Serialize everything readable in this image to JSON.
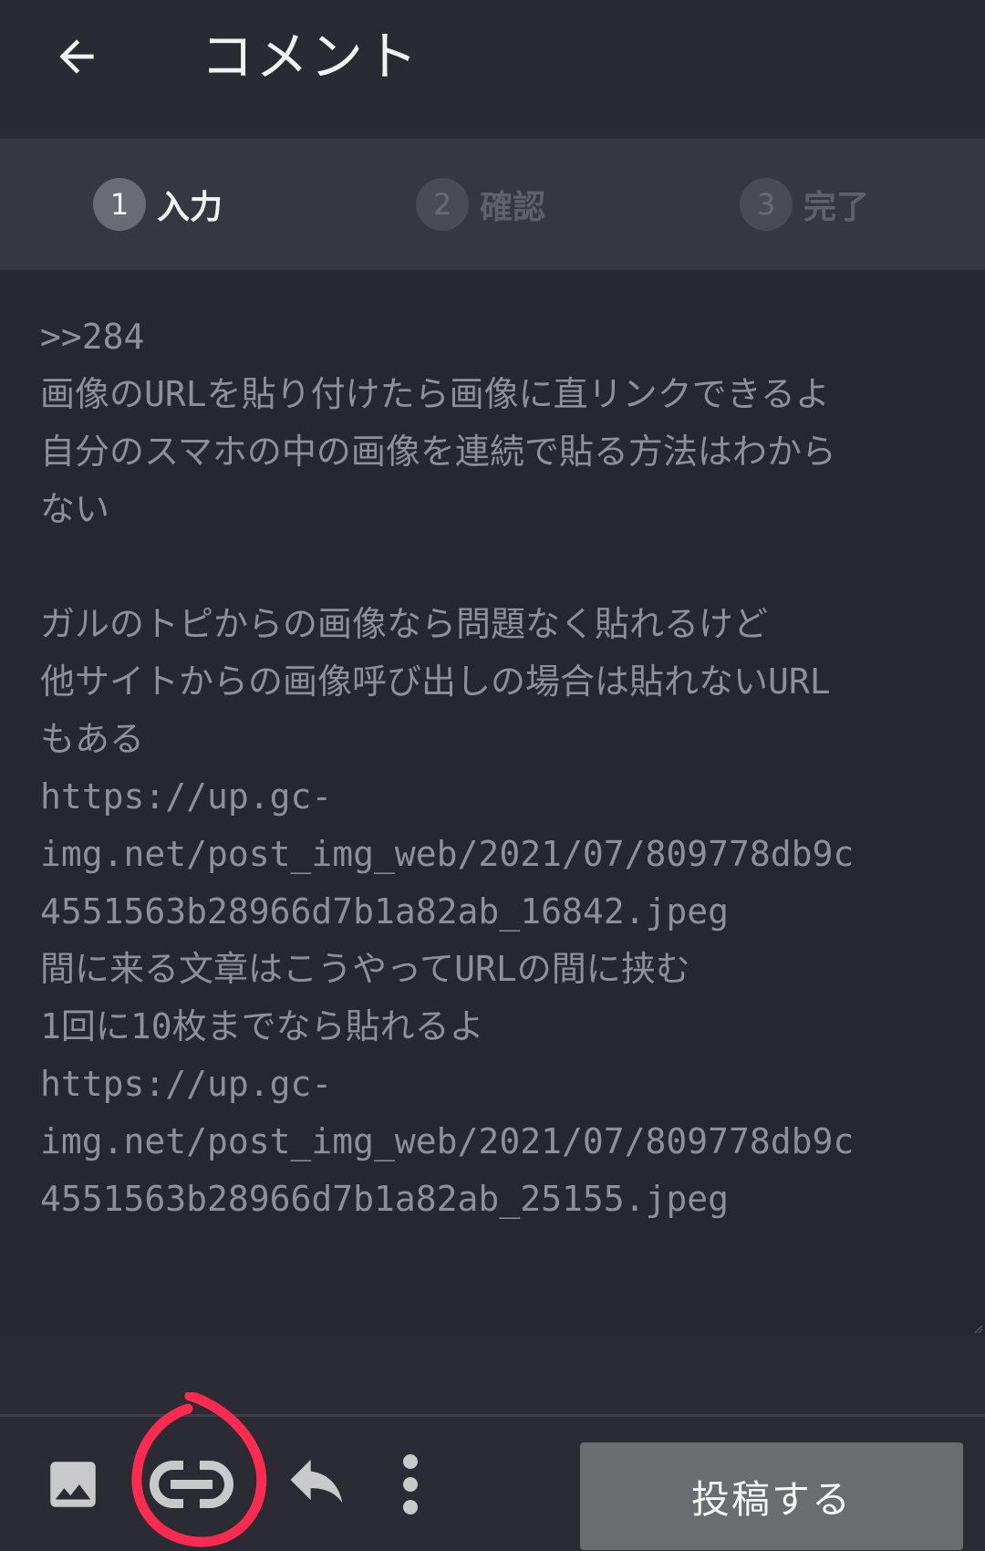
{
  "header": {
    "title": "コメント"
  },
  "steps": [
    {
      "number": "1",
      "label": "入力",
      "active": true
    },
    {
      "number": "2",
      "label": "確認",
      "active": false
    },
    {
      "number": "3",
      "label": "完了",
      "active": false
    }
  ],
  "comment": {
    "text": ">>284\n画像のURLを貼り付けたら画像に直リンクできるよ\n自分のスマホの中の画像を連続で貼る方法はわから\nない\n\nガルのトピからの画像なら問題なく貼れるけど\n他サイトからの画像呼び出しの場合は貼れないURL\nもある\nhttps://up.gc-\nimg.net/post_img_web/2021/07/809778db9c\n4551563b28966d7b1a82ab_16842.jpeg\n間に来る文章はこうやってURLの間に挟む\n1回に10枚までなら貼れるよ\nhttps://up.gc-\nimg.net/post_img_web/2021/07/809778db9c\n4551563b28966d7b1a82ab_25155.jpeg"
  },
  "toolbar": {
    "icons": [
      "image-icon",
      "link-icon",
      "reply-icon",
      "more-vert-icon"
    ],
    "post_label": "投稿する"
  },
  "colors": {
    "annotation": "#ff2a4f",
    "post_button": "#6b6c70"
  }
}
